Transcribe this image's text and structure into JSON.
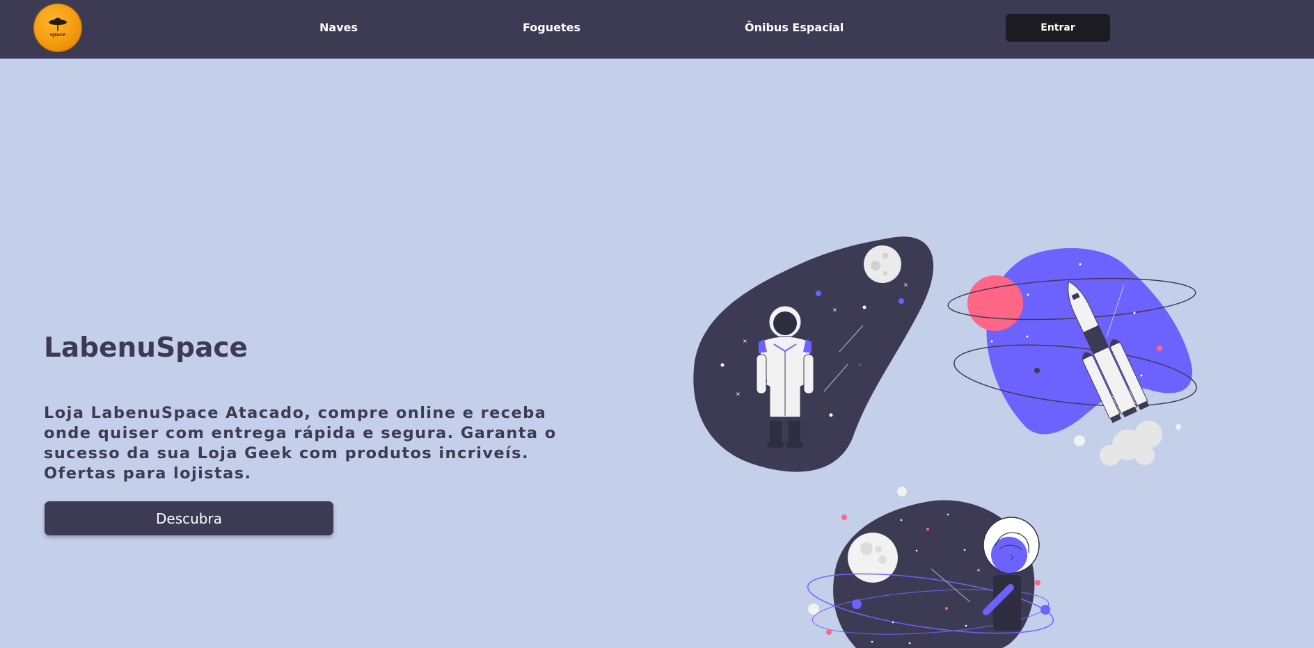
{
  "header": {
    "logo_text": "space",
    "nav": {
      "naves": "Naves",
      "foguetes": "Foguetes",
      "onibus": "Ônibus Espacial"
    },
    "login_label": "Entrar"
  },
  "hero": {
    "title": "LabenuSpace",
    "description": "Loja LabenuSpace Atacado, compre online e receba onde quiser com entrega rápida e segura. Garanta o sucesso da sua Loja Geek com produtos incriveís. Ofertas para lojistas.",
    "cta_label": "Descubra"
  },
  "colors": {
    "nav_bg": "#3d3b53",
    "page_bg": "#c4d0ea",
    "accent": "#6c63ff",
    "pink": "#ff6584",
    "button_dark": "#1c1b22"
  },
  "illustrations": [
    "astronaut-illustration",
    "rocket-illustration",
    "space-explorer-illustration"
  ]
}
